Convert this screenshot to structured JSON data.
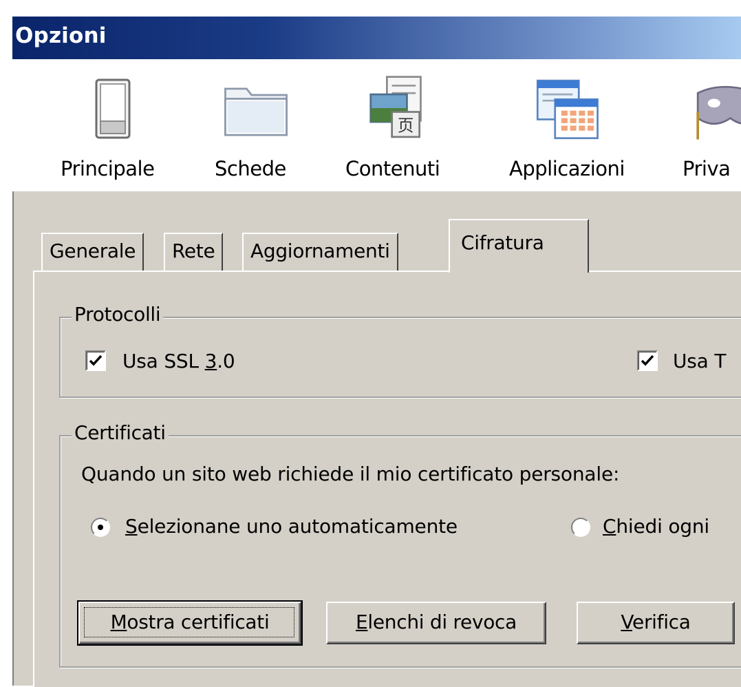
{
  "window": {
    "title": "Opzioni"
  },
  "toolbar": {
    "items": [
      {
        "label": "Principale",
        "icon": "switch-icon"
      },
      {
        "label": "Schede",
        "icon": "folder-icon"
      },
      {
        "label": "Contenuti",
        "icon": "content-icon"
      },
      {
        "label": "Applicazioni",
        "icon": "applications-icon"
      },
      {
        "label": "Priva",
        "icon": "mask-icon"
      }
    ]
  },
  "tabs": {
    "items": [
      {
        "label": "Generale"
      },
      {
        "label": "Rete"
      },
      {
        "label": "Aggiornamenti"
      },
      {
        "label": "Cifratura",
        "active": true
      }
    ]
  },
  "protocols": {
    "legend": "Protocolli",
    "ssl": {
      "label_pre": "Usa SSL ",
      "label_accel": "3",
      "label_post": ".0",
      "checked": true
    },
    "tls": {
      "label": "Usa T",
      "checked": true
    }
  },
  "certificates": {
    "legend": "Certificati",
    "prompt": "Quando un sito web richiede il mio certificato personale:",
    "auto": {
      "label_accel": "S",
      "label_rest": "elezionane uno automaticamente",
      "selected": true
    },
    "ask": {
      "label_accel": "C",
      "label_rest": "hiedi ogni",
      "selected": false
    },
    "buttons": {
      "show": {
        "accel": "M",
        "rest": "ostra certificati"
      },
      "revocation": {
        "accel": "E",
        "rest": "lenchi di revoca"
      },
      "verify": {
        "accel": "V",
        "rest": "erifica"
      }
    }
  }
}
